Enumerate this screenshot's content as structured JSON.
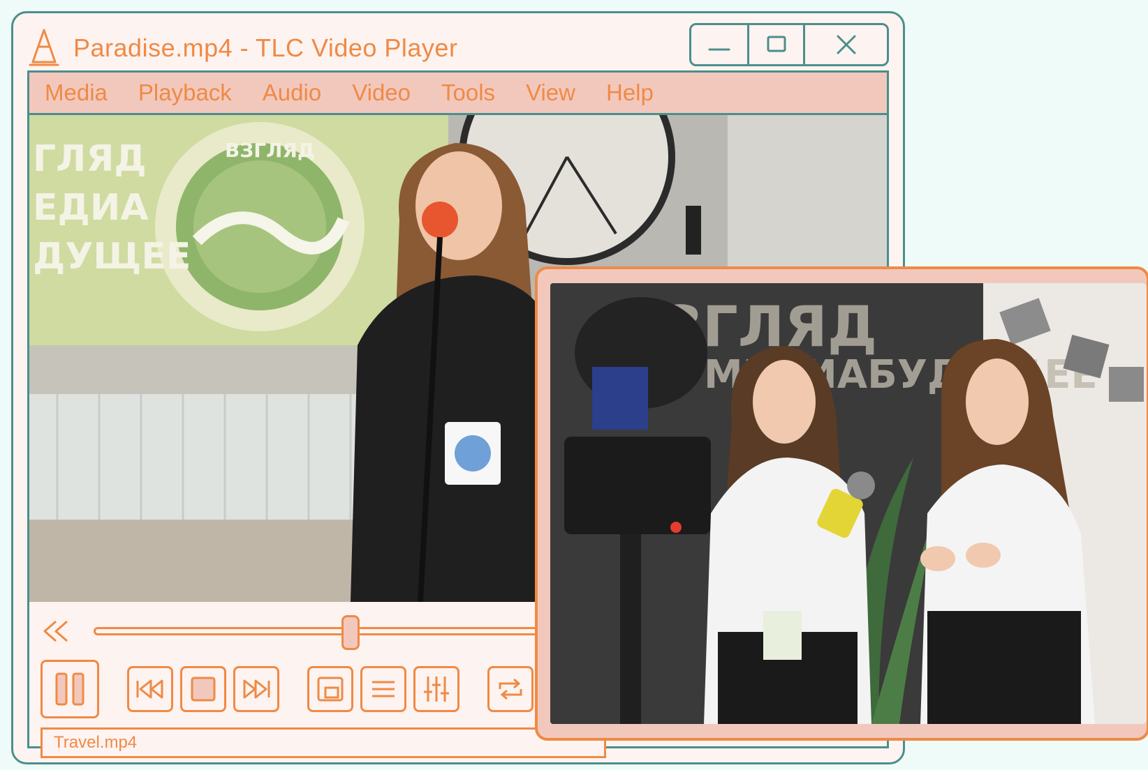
{
  "window": {
    "title": "Paradise.mp4 - TLC Video Player"
  },
  "window_controls": {
    "minimize_icon": "minimize-icon",
    "maximize_icon": "maximize-icon",
    "close_icon": "close-icon"
  },
  "menu": {
    "items": [
      {
        "label": "Media"
      },
      {
        "label": "Playback"
      },
      {
        "label": "Audio"
      },
      {
        "label": "Video"
      },
      {
        "label": "Tools"
      },
      {
        "label": "View"
      },
      {
        "label": "Help"
      }
    ]
  },
  "playback": {
    "position_fraction": 0.33
  },
  "controls": {
    "icons": [
      "pause-icon",
      "skip-back-icon",
      "stop-icon",
      "skip-forward-icon",
      "aspect-icon",
      "playlist-icon",
      "equalizer-icon",
      "loop-icon"
    ]
  },
  "playlist": {
    "current_item": "Travel.mp4"
  },
  "colors": {
    "accent": "#ef8a45",
    "border": "#4a8f8c",
    "menu_bg": "#f2c8bd",
    "window_bg": "#fdf3f0",
    "page_bg": "#eefbf8"
  }
}
